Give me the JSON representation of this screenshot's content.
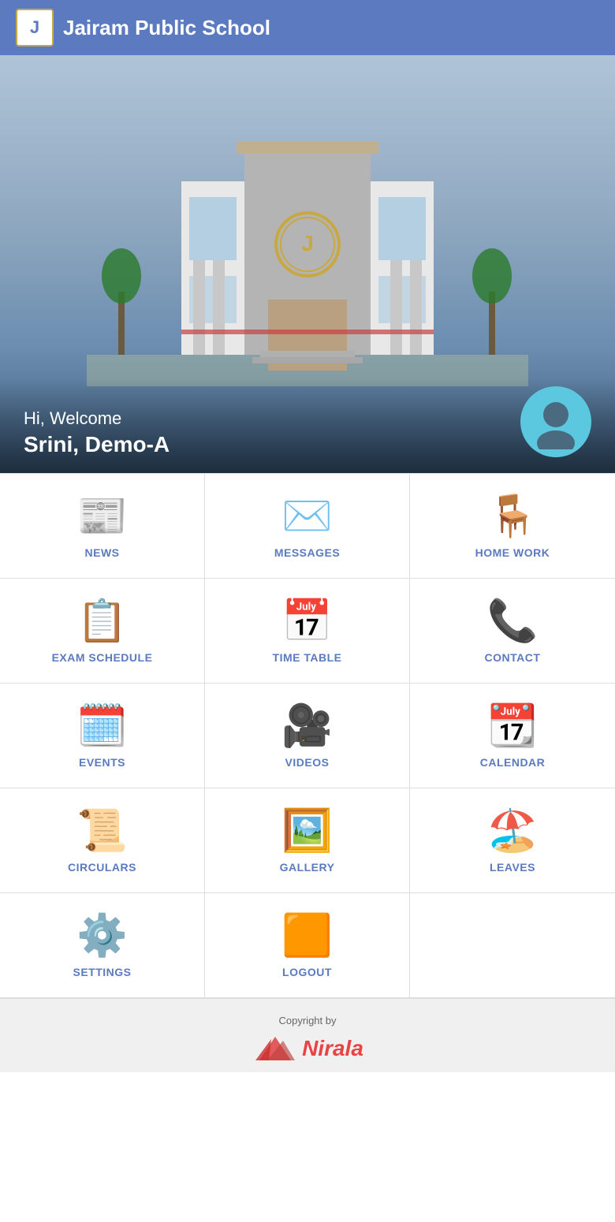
{
  "header": {
    "logo_text": "J",
    "title": "Jairam Public School"
  },
  "hero": {
    "welcome": "Hi, Welcome",
    "name": "Srini, Demo-A"
  },
  "grid": {
    "items": [
      {
        "id": "news",
        "label": "NEWS",
        "icon": "📰"
      },
      {
        "id": "messages",
        "label": "MESSAGES",
        "icon": "✉️"
      },
      {
        "id": "homework",
        "label": "HOME WORK",
        "icon": "🪑"
      },
      {
        "id": "exam-schedule",
        "label": "EXAM SCHEDULE",
        "icon": "📋"
      },
      {
        "id": "time-table",
        "label": "TIME TABLE",
        "icon": "📅"
      },
      {
        "id": "contact",
        "label": "CONTACT",
        "icon": "📞"
      },
      {
        "id": "events",
        "label": "EVENTS",
        "icon": "🗓️"
      },
      {
        "id": "videos",
        "label": "VIDEOS",
        "icon": "🎥"
      },
      {
        "id": "calendar",
        "label": "CALENDAR",
        "icon": "📆"
      },
      {
        "id": "circulars",
        "label": "CIRCULARS",
        "icon": "📜"
      },
      {
        "id": "gallery",
        "label": "GALLERY",
        "icon": "🖼️"
      },
      {
        "id": "leaves",
        "label": "LEAVES",
        "icon": "🏖️"
      },
      {
        "id": "settings",
        "label": "SETTINGS",
        "icon": "⚙️"
      },
      {
        "id": "logout",
        "label": "LOGOUT",
        "icon": "🟧"
      }
    ]
  },
  "footer": {
    "copyright": "Copyright by",
    "brand": "Nirala"
  }
}
